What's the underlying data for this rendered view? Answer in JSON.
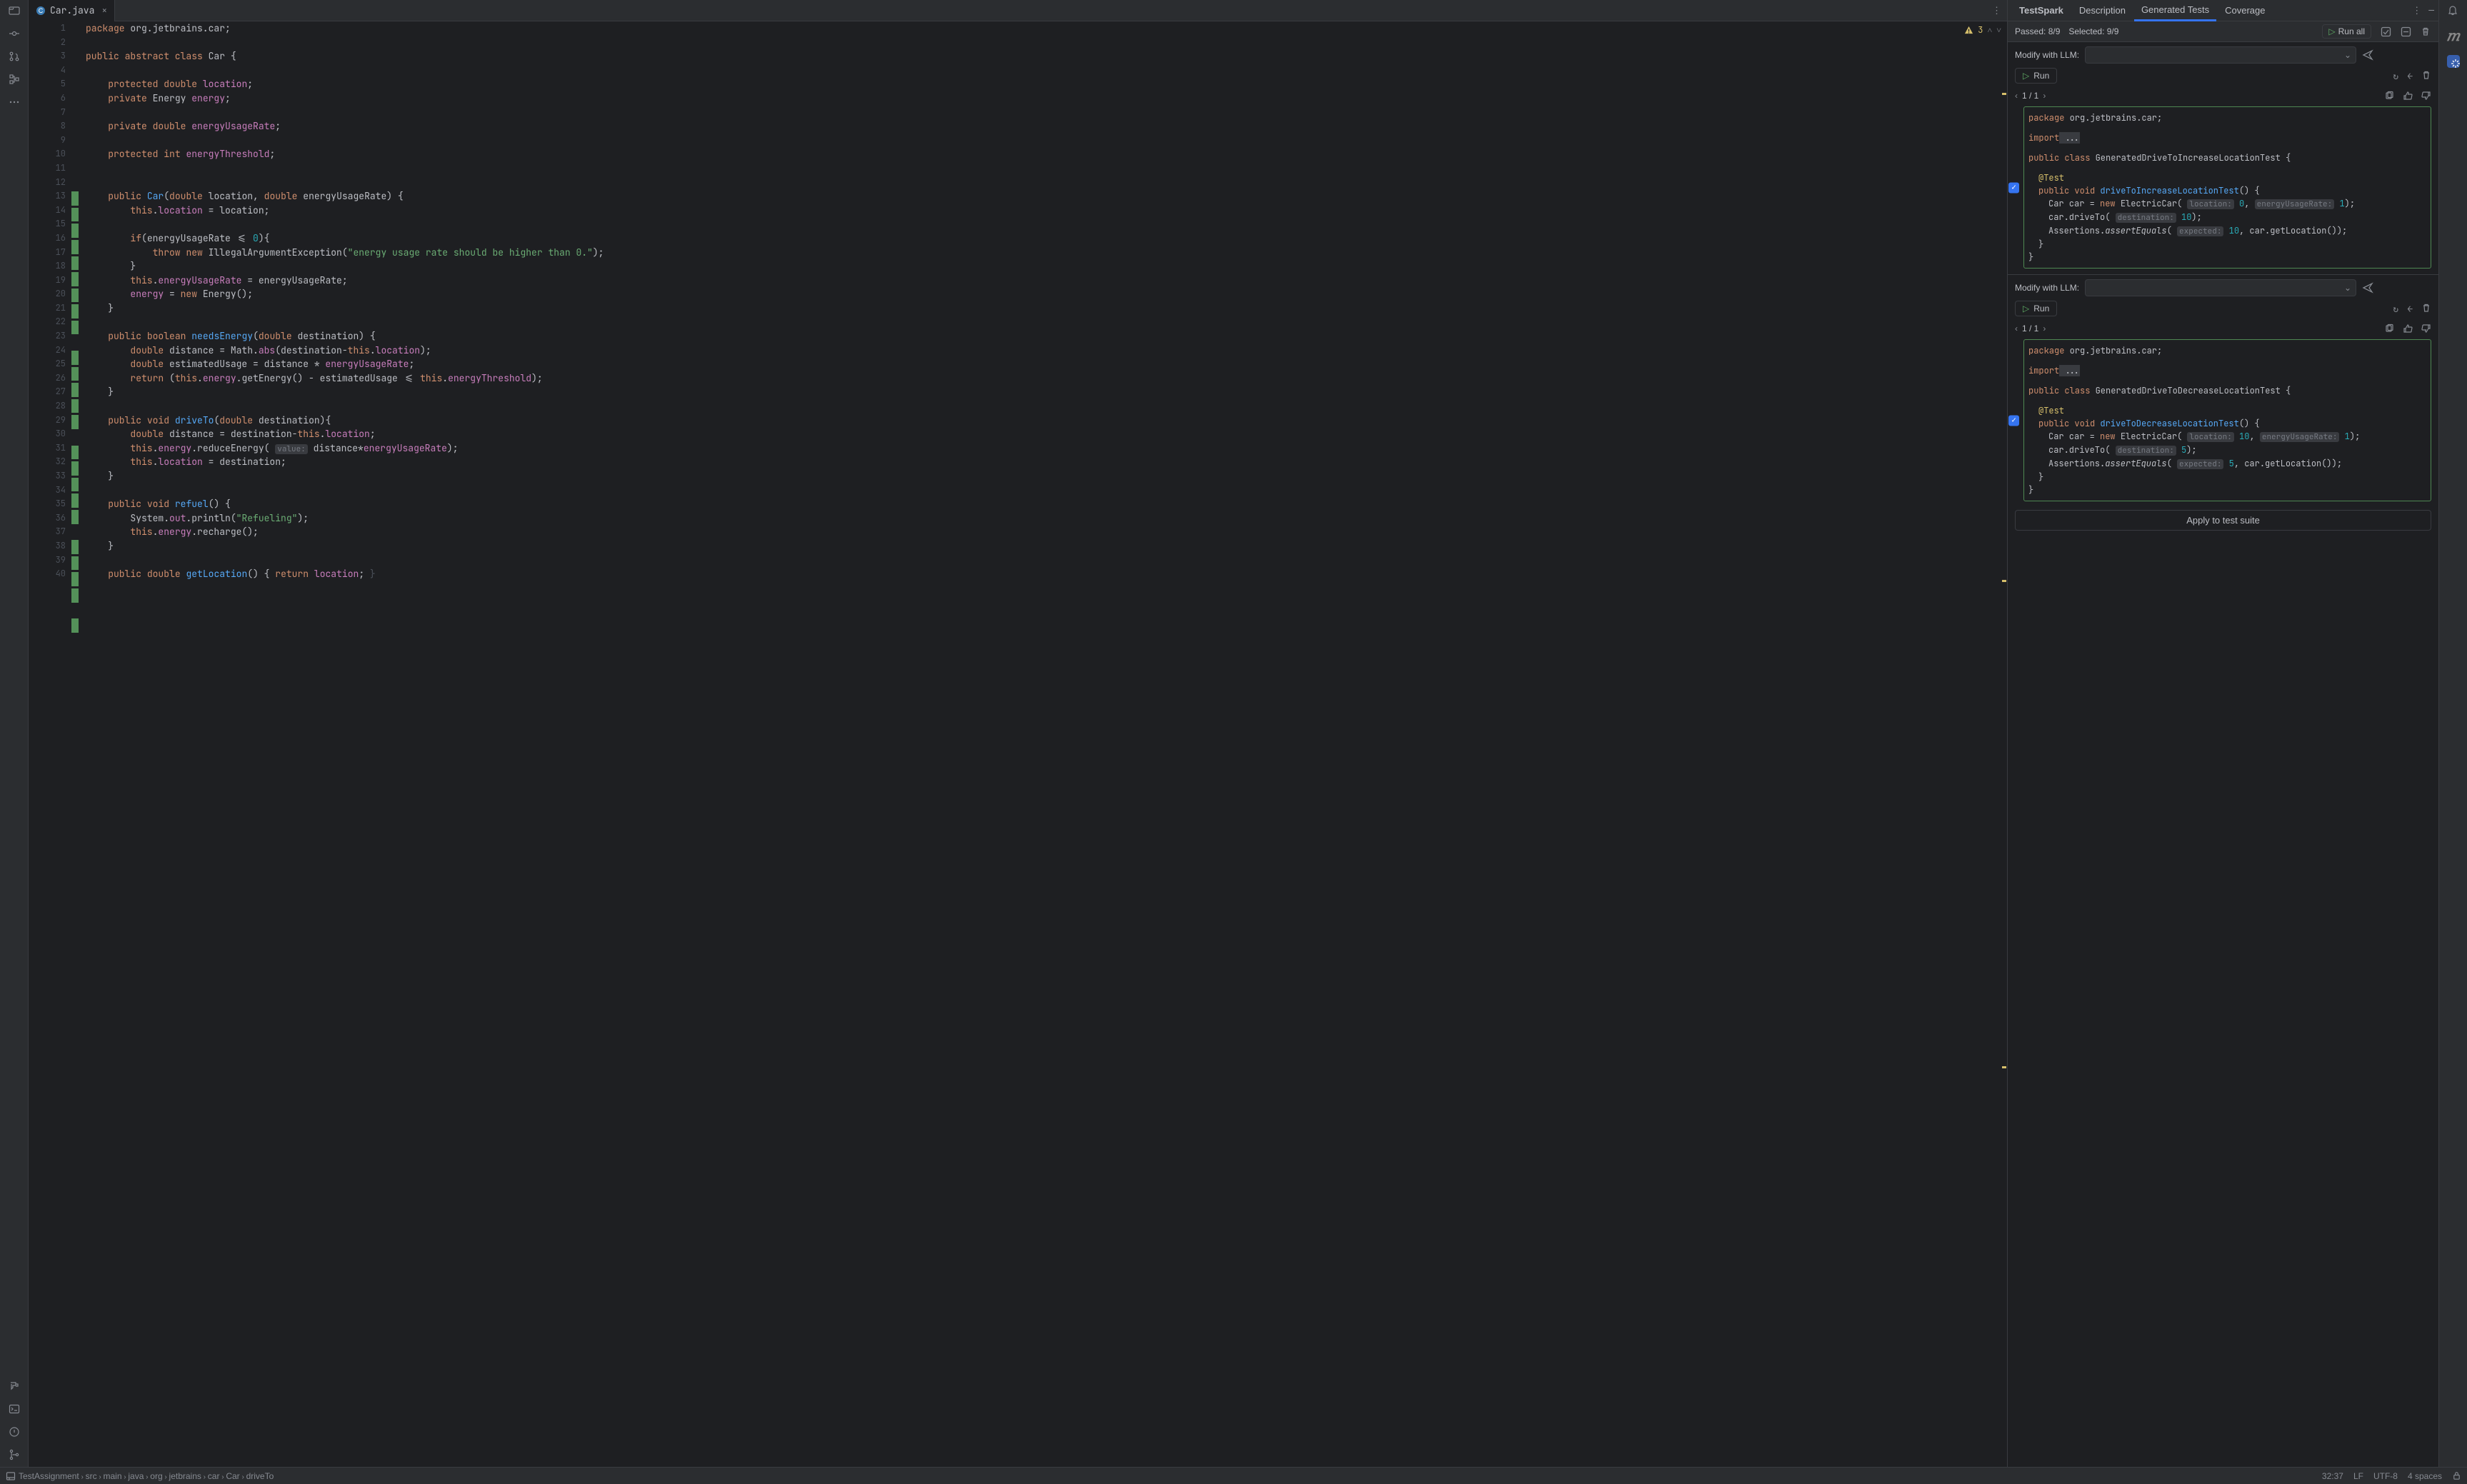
{
  "tab": {
    "name": "Car.java",
    "close": "×"
  },
  "editor": {
    "problems": "3",
    "lines": [
      {
        "n": 1,
        "html": "<span class='kw'>package</span> org.jetbrains.car;"
      },
      {
        "n": 2,
        "html": ""
      },
      {
        "n": 3,
        "html": "<span class='kw'>public abstract class</span> Car {"
      },
      {
        "n": 4,
        "html": ""
      },
      {
        "n": 5,
        "html": "    <span class='kw'>protected</span> <span class='kw'>double</span> <span class='fld'>location</span>;"
      },
      {
        "n": 6,
        "html": "    <span class='kw'>private</span> Energy <span class='fld'>energy</span>;"
      },
      {
        "n": 7,
        "html": ""
      },
      {
        "n": 8,
        "html": "    <span class='kw'>private</span> <span class='kw'>double</span> <span class='fld'>energyUsageRate</span>;"
      },
      {
        "n": 9,
        "html": ""
      },
      {
        "n": 10,
        "html": "    <span class='kw'>protected</span> <span class='kw'>int</span> <span class='fld'>energyThreshold</span>;"
      },
      {
        "n": 11,
        "html": ""
      },
      {
        "n": 12,
        "html": ""
      },
      {
        "n": 13,
        "g": 1,
        "html": "    <span class='kw'>public</span> <span class='mth'>Car</span>(<span class='kw'>double</span> location, <span class='kw'>double</span> energyUsageRate) {"
      },
      {
        "n": 14,
        "g": 1,
        "html": "        <span class='kw'>this</span>.<span class='fld'>location</span> = location;"
      },
      {
        "n": 15,
        "g": 1,
        "html": ""
      },
      {
        "n": 16,
        "g": 1,
        "html": "        <span class='kw'>if</span>(energyUsageRate <= <span class='num'>0</span>){"
      },
      {
        "n": 17,
        "g": 1,
        "html": "            <span class='kw'>throw</span> <span class='kw'>new</span> IllegalArgumentException(<span class='str'>\"energy usage rate should be higher than 0.\"</span>);"
      },
      {
        "n": 18,
        "g": 1,
        "html": "        }"
      },
      {
        "n": 19,
        "g": 1,
        "html": "        <span class='kw'>this</span>.<span class='fld'>energyUsageRate</span> = energyUsageRate;"
      },
      {
        "n": 20,
        "g": 1,
        "html": "        <span class='fld'>energy</span> = <span class='kw'>new</span> Energy();"
      },
      {
        "n": 21,
        "g": 1,
        "html": "    }"
      },
      {
        "n": 22,
        "html": ""
      },
      {
        "n": 23,
        "g": 1,
        "html": "    <span class='kw'>public</span> <span class='kw'>boolean</span> <span class='mth'>needsEnergy</span>(<span class='kw'>double</span> destination) {"
      },
      {
        "n": 24,
        "g": 1,
        "html": "        <span class='kw'>double</span> distance = Math.<span class='fld'>abs</span>(destination-<span class='kw'>this</span>.<span class='fld'>location</span>);"
      },
      {
        "n": 25,
        "g": 1,
        "html": "        <span class='kw'>double</span> estimatedUsage = distance * <span class='fld'>energyUsageRate</span>;"
      },
      {
        "n": 26,
        "g": 1,
        "html": "        <span class='kw'>return</span> (<span class='kw'>this</span>.<span class='fld'>energy</span>.getEnergy() - estimatedUsage <= <span class='kw'>this</span>.<span class='fld'>energyThreshold</span>);"
      },
      {
        "n": 27,
        "g": 1,
        "html": "    }"
      },
      {
        "n": 28,
        "html": ""
      },
      {
        "n": 29,
        "g": 1,
        "html": "    <span class='kw'>public</span> <span class='kw'>void</span> <span class='mth'>driveTo</span>(<span class='kw'>double</span> destination){"
      },
      {
        "n": 30,
        "g": 1,
        "html": "        <span class='kw'>double</span> distance = destination-<span class='kw'>this</span>.<span class='fld'>location</span>;"
      },
      {
        "n": 31,
        "g": 1,
        "html": "        <span class='kw'>this</span>.<span class='fld'>energy</span>.reduceEnergy( <span class='hint'>value:</span> distance*<span class='fld'>energyUsageRate</span>);"
      },
      {
        "n": 32,
        "g": 1,
        "html": "        <span class='kw'>this</span>.<span class='fld'>location</span> = destination;"
      },
      {
        "n": 33,
        "g": 1,
        "html": "    }"
      },
      {
        "n": 34,
        "html": ""
      },
      {
        "n": 35,
        "g": 1,
        "html": "    <span class='kw'>public</span> <span class='kw'>void</span> <span class='mth'>refuel</span>() {"
      },
      {
        "n": 36,
        "g": 1,
        "html": "        System.<span class='fld'>out</span>.println(<span class='str'>\"Refueling\"</span>);"
      },
      {
        "n": 37,
        "g": 1,
        "html": "        <span class='kw'>this</span>.<span class='fld'>energy</span>.recharge();"
      },
      {
        "n": 38,
        "g": 1,
        "html": "    }"
      },
      {
        "n": 39,
        "html": ""
      },
      {
        "n": 40,
        "g": 1,
        "fold": ">",
        "html": "    <span class='kw'>public</span> <span class='kw'>double</span> <span class='mth'>getLocation</span>() { <span class='kw'>return</span> <span class='fld'>location</span>; <span style='color:#4b5059'>}</span>"
      }
    ]
  },
  "rpanel": {
    "tabs": [
      "TestSpark",
      "Description",
      "Generated Tests",
      "Coverage"
    ],
    "active_tab": 2,
    "passed": "Passed: 8/9",
    "selected": "Selected: 9/9",
    "runall": "Run all",
    "modify_label": "Modify with LLM:",
    "run_label": "Run",
    "pager": "1 / 1",
    "apply": "Apply to test suite",
    "logo": "𝑚",
    "test1": {
      "package": "package",
      "pkg_name": " org.jetbrains.car;",
      "import": "import",
      "import_rest": " ...",
      "class_decl_kw": "public class",
      "class_name": " GeneratedDriveToIncreaseLocationTest {",
      "ann": "@Test",
      "sig_kw": "public void",
      "sig_name": "driveToIncreaseLocationTest",
      "sig_rest": "() {",
      "l1a": "Car car = ",
      "l1new": "new",
      "l1b": " ElectricCar( ",
      "l1h1": "location:",
      "l1v1": " 0",
      "l1c": ", ",
      "l1h2": "energyUsageRate:",
      "l1v2": " 1",
      "l1d": ");",
      "l2a": "car.driveTo( ",
      "l2h": "destination:",
      "l2v": " 10",
      "l2b": ");",
      "l3a": "Assertions.",
      "l3m": "assertEquals",
      "l3b": "( ",
      "l3h": "expected:",
      "l3v": " 10",
      "l3c": ", car.getLocation());",
      "close1": "}",
      "close2": "}"
    },
    "test2": {
      "package": "package",
      "pkg_name": " org.jetbrains.car;",
      "import": "import",
      "import_rest": " ...",
      "class_decl_kw": "public class",
      "class_name": " GeneratedDriveToDecreaseLocationTest {",
      "ann": "@Test",
      "sig_kw": "public void",
      "sig_name": "driveToDecreaseLocationTest",
      "sig_rest": "() {",
      "l1a": "Car car = ",
      "l1new": "new",
      "l1b": " ElectricCar( ",
      "l1h1": "location:",
      "l1v1": " 10",
      "l1c": ", ",
      "l1h2": "energyUsageRate:",
      "l1v2": " 1",
      "l1d": ");",
      "l2a": "car.driveTo( ",
      "l2h": "destination:",
      "l2v": " 5",
      "l2b": ");",
      "l3a": "Assertions.",
      "l3m": "assertEquals",
      "l3b": "( ",
      "l3h": "expected:",
      "l3v": " 5",
      "l3c": ", car.getLocation());",
      "close1": "}",
      "close2": "}"
    }
  },
  "status": {
    "crumbs": [
      "TestAssignment",
      "src",
      "main",
      "java",
      "org",
      "jetbrains",
      "car",
      "Car",
      "driveTo"
    ],
    "pos": "32:37",
    "lf": "LF",
    "enc": "UTF-8",
    "indent": "4 spaces"
  }
}
